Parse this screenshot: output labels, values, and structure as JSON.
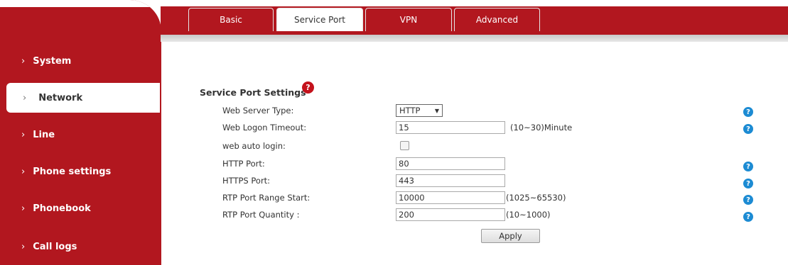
{
  "sidebar": {
    "items": [
      {
        "label": "System",
        "active": false
      },
      {
        "label": "Network",
        "active": true
      },
      {
        "label": "Line",
        "active": false
      },
      {
        "label": "Phone settings",
        "active": false
      },
      {
        "label": "Phonebook",
        "active": false
      },
      {
        "label": "Call logs",
        "active": false
      }
    ],
    "chevron": "›"
  },
  "tabs": [
    {
      "label": "Basic",
      "active": false
    },
    {
      "label": "Service Port",
      "active": true
    },
    {
      "label": "VPN",
      "active": false
    },
    {
      "label": "Advanced",
      "active": false
    }
  ],
  "section": {
    "title": "Service Port Settings",
    "title_icon": "?"
  },
  "fields": {
    "web_server_type": {
      "label": "Web Server Type:",
      "value": "HTTP",
      "arrow": "▼"
    },
    "web_logon_timeout": {
      "label": "Web Logon Timeout:",
      "value": "15",
      "unit": "(10~30)Minute"
    },
    "web_auto_login": {
      "label": "web auto login:",
      "checked": false
    },
    "http_port": {
      "label": "HTTP Port:",
      "value": "80"
    },
    "https_port": {
      "label": "HTTPS Port:",
      "value": "443"
    },
    "rtp_port_range_start": {
      "label": "RTP Port Range Start:",
      "value": "10000",
      "unit": "(1025~65530)"
    },
    "rtp_port_quantity": {
      "label": "RTP Port Quantity :",
      "value": "200",
      "unit": "(10~1000)"
    }
  },
  "help_icon": "?",
  "apply_label": "Apply",
  "colors": {
    "brand_red": "#b2171f",
    "help_blue": "#1c8bd3"
  }
}
